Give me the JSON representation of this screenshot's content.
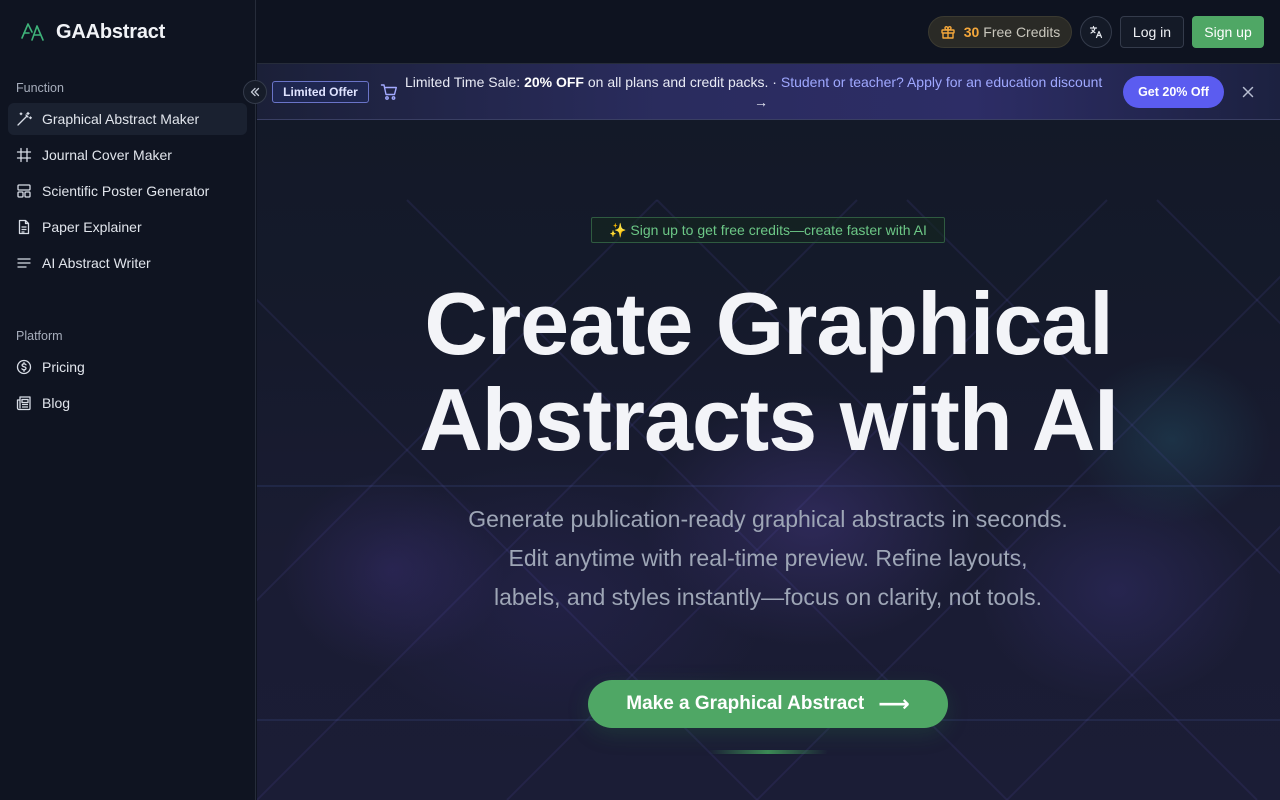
{
  "brand": {
    "name": "GAAbstract"
  },
  "sidebar": {
    "function_label": "Function",
    "function_items": [
      {
        "label": "Graphical Abstract Maker",
        "icon": "magic-wand-icon",
        "active": true
      },
      {
        "label": "Journal Cover Maker",
        "icon": "hash-icon"
      },
      {
        "label": "Scientific Poster Generator",
        "icon": "layout-icon"
      },
      {
        "label": "Paper Explainer",
        "icon": "document-icon"
      },
      {
        "label": "AI Abstract Writer",
        "icon": "text-lines-icon"
      }
    ],
    "platform_label": "Platform",
    "platform_items": [
      {
        "label": "Pricing",
        "icon": "dollar-circle-icon"
      },
      {
        "label": "Blog",
        "icon": "newspaper-icon"
      }
    ]
  },
  "topbar": {
    "credits_count": "30",
    "credits_label": "Free Credits",
    "login": "Log in",
    "signup": "Sign up"
  },
  "banner": {
    "tag": "Limited Offer",
    "prefix": "Limited Time Sale: ",
    "highlight": "20% OFF",
    "middle": " on all plans and credit packs. · ",
    "link": "Student or teacher? Apply for an education discount",
    "arrow": "→",
    "cta": "Get 20% Off"
  },
  "hero": {
    "badge": "✨ Sign up to get free credits—create faster with AI",
    "title_line1": "Create Graphical",
    "title_line2": "Abstracts with AI",
    "sub_line1": "Generate publication-ready graphical abstracts in seconds.",
    "sub_line2": "Edit anytime with real-time preview. Refine layouts,",
    "sub_line3": "labels, and styles instantly—focus on clarity, not tools.",
    "cta": "Make a Graphical Abstract",
    "cta_arrow": "⟶"
  },
  "colors": {
    "accent_green": "#4fa765",
    "accent_purple": "#5b5cf0",
    "credits_orange": "#f4a73b",
    "background": "#0e1320"
  }
}
